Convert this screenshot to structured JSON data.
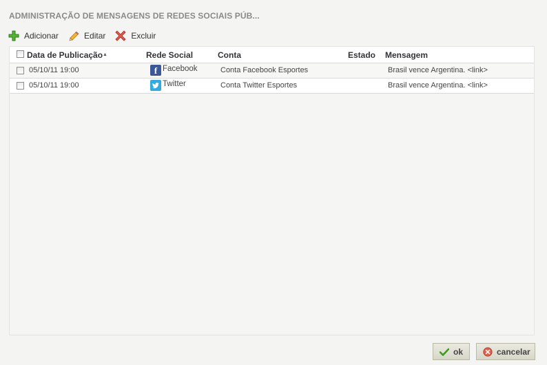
{
  "dialog": {
    "title": "ADMINISTRAÇÃO DE MENSAGENS DE REDES SOCIAIS PÚB..."
  },
  "toolbar": {
    "add_label": "Adicionar",
    "edit_label": "Editar",
    "delete_label": "Excluir"
  },
  "table": {
    "columns": {
      "date": "Data de Publicação",
      "network": "Rede Social",
      "account": "Conta",
      "state": "Estado",
      "message": "Mensagem"
    },
    "sort": {
      "column": "date",
      "direction": "ascending"
    },
    "rows": [
      {
        "date": "05/10/11 19:00",
        "network": "Facebook",
        "network_icon": "facebook-icon",
        "account": "Conta Facebook Esportes",
        "state": "",
        "message": "Brasil vence Argentina. <link>"
      },
      {
        "date": "05/10/11 19:00",
        "network": "Twitter",
        "network_icon": "twitter-icon",
        "account": "Conta Twitter Esportes",
        "state": "",
        "message": "Brasil vence Argentina. <link>"
      }
    ]
  },
  "footer": {
    "ok_label": "ok",
    "cancel_label": "cancelar"
  },
  "colors": {
    "facebook": "#3b5998",
    "twitter": "#33a9e0",
    "add_green": "#4aa82a",
    "delete_red": "#d9473a"
  }
}
